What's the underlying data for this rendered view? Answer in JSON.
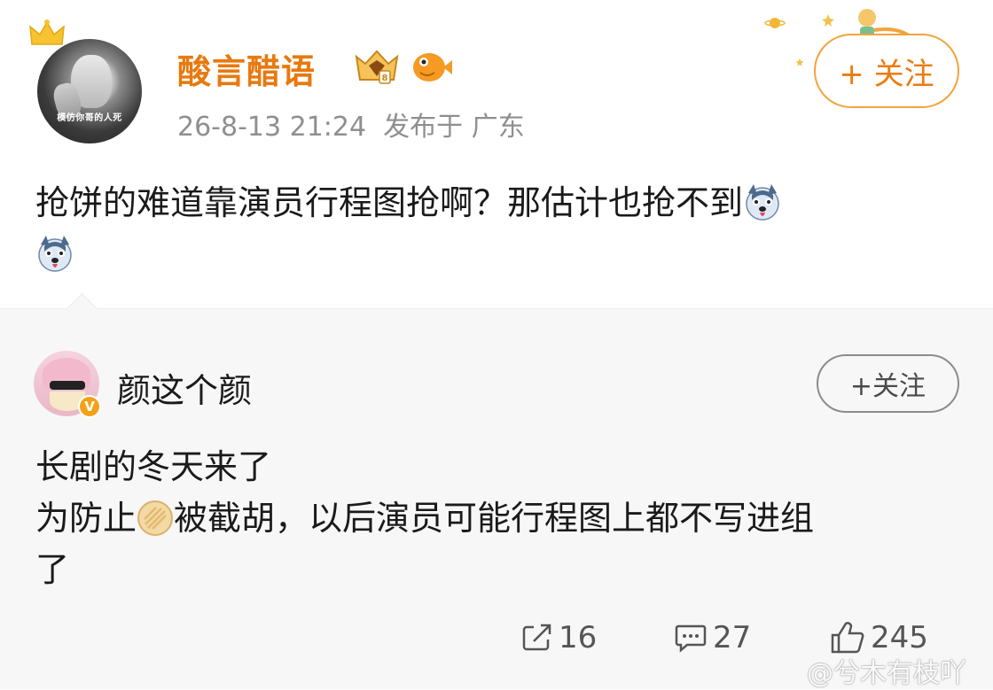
{
  "post": {
    "username": "酸言醋语",
    "avatar_caption": "模仿你哥的人死",
    "timestamp": "26-8-13 21:24",
    "location": "发布于 广东",
    "follow_label": "+ 关注",
    "body": "抢饼的难道靠演员行程图抢啊？那估计也抢不到",
    "emoji_icon": "husky-dog-emoji-icon"
  },
  "comment": {
    "username": "颜这个颜",
    "verified_mark": "V",
    "follow_label": "+关注",
    "line1": "长剧的冬天来了",
    "line2_before": "为防止",
    "line2_icon": "cake-icon",
    "line2_after": "被截胡，以后演员可能行程图上都不写进组",
    "line3": "了"
  },
  "actions": {
    "repost_count": "16",
    "comment_count": "27",
    "like_count": "245"
  },
  "watermark": "@兮木有枝吖",
  "colors": {
    "accent": "#e8790f",
    "follow_border": "#f2a33c",
    "muted": "#8f8f8f",
    "panel_bg": "#f7f7f7"
  }
}
